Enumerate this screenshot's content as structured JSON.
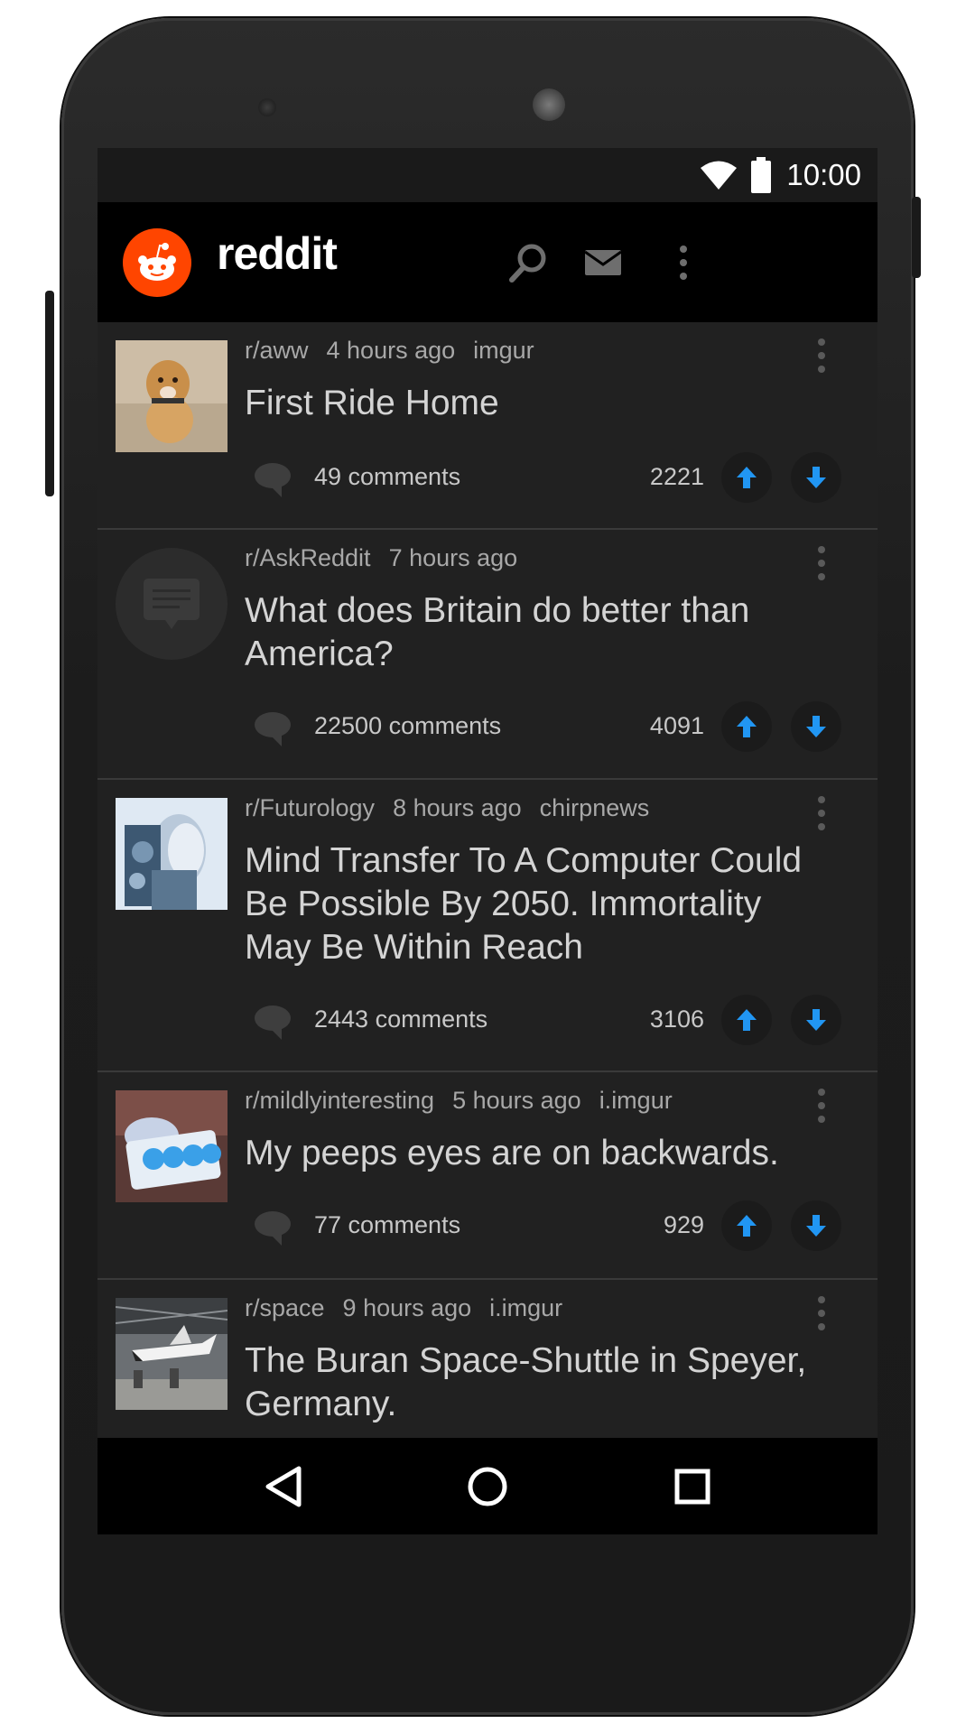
{
  "status": {
    "time": "10:00"
  },
  "appbar": {
    "brand": "reddit"
  },
  "colors": {
    "accent": "#ff4500",
    "vote": "#2196f3",
    "background": "#212121"
  },
  "posts": [
    {
      "subreddit": "r/aww",
      "age": "4 hours ago",
      "domain": "imgur",
      "title": "First Ride Home",
      "comments": "49 comments",
      "score": "2221",
      "thumbnail": "dog-photo"
    },
    {
      "subreddit": "r/AskReddit",
      "age": "7 hours ago",
      "domain": "",
      "title": "What does Britain do better than America?",
      "comments": "22500 comments",
      "score": "4091",
      "thumbnail": "self-post-icon"
    },
    {
      "subreddit": "r/Futurology",
      "age": "8 hours ago",
      "domain": "chirpnews",
      "title": "Mind Transfer To A Computer Could Be Possible By 2050. Immortality May Be Within Reach",
      "comments": "2443 comments",
      "score": "3106",
      "thumbnail": "robot-photo"
    },
    {
      "subreddit": "r/mildlyinteresting",
      "age": "5 hours ago",
      "domain": "i.imgur",
      "title": "My peeps eyes are on backwards.",
      "comments": "77 comments",
      "score": "929",
      "thumbnail": "peeps-photo"
    },
    {
      "subreddit": "r/space",
      "age": "9 hours ago",
      "domain": "i.imgur",
      "title": "The Buran Space-Shuttle in Speyer, Germany.",
      "comments": "",
      "score": "",
      "thumbnail": "shuttle-photo"
    }
  ]
}
